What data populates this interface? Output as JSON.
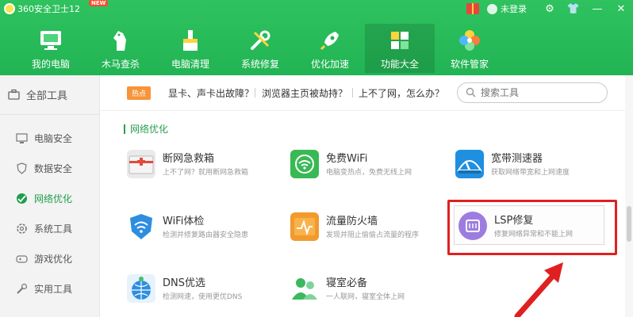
{
  "titlebar": {
    "app_title": "360安全卫士12",
    "new_badge": "NEW",
    "login": "未登录"
  },
  "nav": [
    {
      "label": "我的电脑",
      "icon": "monitor-icon"
    },
    {
      "label": "木马查杀",
      "icon": "horse-icon"
    },
    {
      "label": "电脑清理",
      "icon": "broom-icon"
    },
    {
      "label": "系统修复",
      "icon": "wrench-icon"
    },
    {
      "label": "优化加速",
      "icon": "rocket-icon"
    },
    {
      "label": "功能大全",
      "icon": "grid-icon",
      "active": true
    },
    {
      "label": "软件管家",
      "icon": "flower-icon"
    }
  ],
  "sidebar": {
    "all": "全部工具",
    "items": [
      {
        "label": "电脑安全",
        "icon": "computer-icon"
      },
      {
        "label": "数据安全",
        "icon": "shield-icon"
      },
      {
        "label": "网络优化",
        "icon": "globe-icon",
        "active": true
      },
      {
        "label": "系统工具",
        "icon": "gear-icon"
      },
      {
        "label": "游戏优化",
        "icon": "gamepad-icon"
      },
      {
        "label": "实用工具",
        "icon": "tool-icon"
      }
    ]
  },
  "hot": {
    "badge": "热点",
    "links": [
      "显卡、声卡出故障？",
      "浏览器主页被劫持？",
      "上不了网，怎么办？"
    ]
  },
  "search": {
    "placeholder": "搜索工具"
  },
  "section": {
    "title": "网络优化"
  },
  "tools": [
    {
      "name": "断网急救箱",
      "desc": "上不了网？就用断网急救箱",
      "icon": "firstaid-icon"
    },
    {
      "name": "免费WiFi",
      "desc": "电脑变热点，免费无线上网",
      "icon": "wifi-free-icon"
    },
    {
      "name": "宽带测速器",
      "desc": "获取网络带宽和上网速度",
      "icon": "speedometer-icon"
    },
    {
      "name": "WiFi体检",
      "desc": "检测并修复路由器安全隐患",
      "icon": "wifi-shield-icon"
    },
    {
      "name": "流量防火墙",
      "desc": "发现并阻止偷偷占流量的程序",
      "icon": "firewall-icon"
    },
    {
      "name": "LSP修复",
      "desc": "修复网络异常和不能上网",
      "icon": "lsp-icon"
    },
    {
      "name": "DNS优选",
      "desc": "检测网速，使用更优DNS",
      "icon": "dns-icon"
    },
    {
      "name": "寝室必备",
      "desc": "一人联网，寝室全体上网",
      "icon": "dorm-icon"
    }
  ],
  "colors": {
    "brand": "#22b454",
    "accent": "#1e9f4a",
    "highlight": "#e02020"
  }
}
